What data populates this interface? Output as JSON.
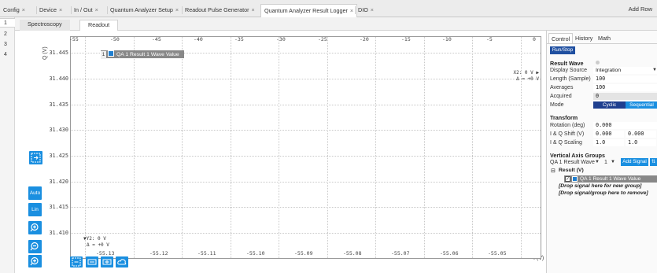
{
  "top_tabs": [
    {
      "label": "Config",
      "close": "×"
    },
    {
      "label": "Device",
      "close": "×"
    },
    {
      "label": "In / Out",
      "close": "×"
    },
    {
      "label": "Quantum Analyzer Setup",
      "close": "×"
    },
    {
      "label": "Readout Pulse Generator",
      "close": "×"
    },
    {
      "label": "Quantum Analyzer Result Logger",
      "close": "×"
    },
    {
      "label": "DIO",
      "close": "×"
    }
  ],
  "add_row": "Add Row",
  "rows": [
    "1",
    "2",
    "3",
    "4"
  ],
  "sub_tabs": [
    "Spectroscopy",
    "Readout"
  ],
  "plot": {
    "y_axis_label": "Q (V)",
    "x_axis_label": "I (V)",
    "y_ticks": [
      "31.445",
      "31.440",
      "31.435",
      "31.430",
      "31.425",
      "31.420",
      "31.415",
      "31.410"
    ],
    "top_ticks": [
      "-55",
      "-50",
      "-45",
      "-40",
      "-35",
      "-30",
      "-25",
      "-20",
      "-15",
      "-10",
      "-5",
      "0"
    ],
    "bottom_ticks": [
      "-55.13",
      "-55.12",
      "-55.11",
      "-55.10",
      "-55.09",
      "-55.08",
      "-55.07",
      "-55.06",
      "-55.05"
    ],
    "legend": {
      "index": "1",
      "label": "QA 1 Result 1 Wave Value",
      "color": "#1f7fd0"
    },
    "cursor_x": {
      "line1": "X2: 0 V ▶",
      "line2": "Δ = +0 V"
    },
    "cursor_y": {
      "line1": "▼Y2: 0 V",
      "line2": "Δ = +0 V"
    }
  },
  "tools": {
    "auto": "Auto",
    "lin": "Lin"
  },
  "panel": {
    "tabs": [
      "Control",
      "History",
      "Math"
    ],
    "run_stop": "Run/Stop",
    "result_wave_title": "Result Wave",
    "display_source_label": "Display Source",
    "display_source_value": "Integration",
    "length_label": "Length (Sample)",
    "length_value": "100",
    "averages_label": "Averages",
    "averages_value": "100",
    "acquired_label": "Acquired",
    "acquired_value": "0",
    "mode_label": "Mode",
    "mode_options": [
      "Cyclic",
      "Sequential"
    ],
    "transform_title": "Transform",
    "rotation_label": "Rotation (deg)",
    "rotation_value": "0.000",
    "iq_shift_label": "I & Q Shift (V)",
    "iq_shift_i": "0.000",
    "iq_shift_q": "0.000",
    "iq_scaling_label": "I & Q Scaling",
    "iq_scaling_i": "1.0",
    "iq_scaling_q": "1.0",
    "vag_title": "Vertical Axis Groups",
    "vag_signal": "QA 1 Result Wave",
    "vag_index": "1",
    "add_signal": "Add Signal",
    "tree_group": "Result (V)",
    "tree_signal": "QA 1 Result 1 Wave Value",
    "drop_new": "[Drop signal here for new group]",
    "drop_remove": "[Drop signal/group here to remove]"
  },
  "colors": {
    "accent": "#1a8fe0",
    "run_button": "#1f4fa0",
    "mode_cyclic": "#1f3f8f",
    "mode_sequential": "#1a8fe0"
  }
}
